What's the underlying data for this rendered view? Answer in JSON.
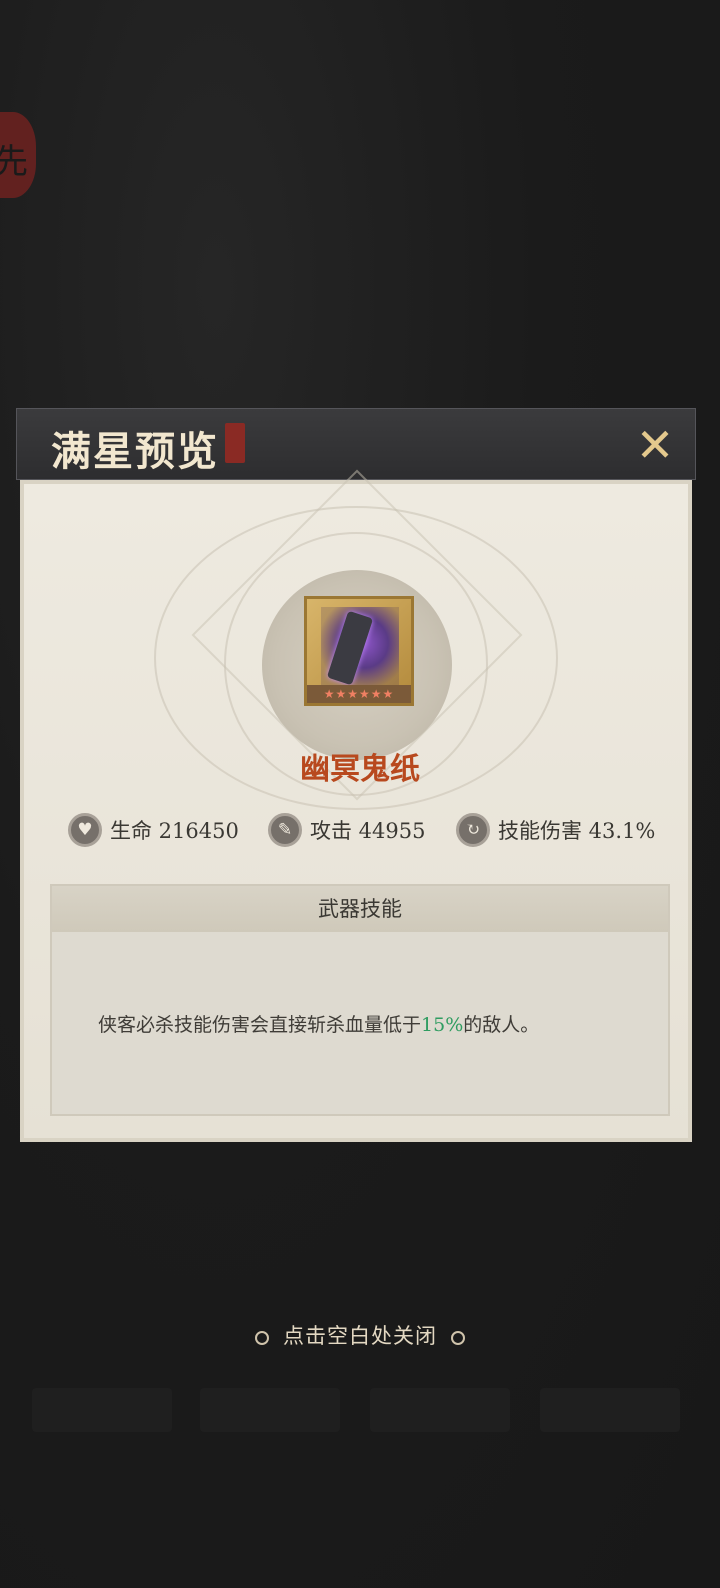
{
  "modal": {
    "title": "满星预览",
    "close_icon": "close-x-icon"
  },
  "weapon": {
    "name": "幽冥鬼纸",
    "stars": "★★★★★★",
    "star_count": 6
  },
  "stats": [
    {
      "icon": "heart-icon",
      "label": "生命 216450"
    },
    {
      "icon": "claw-icon",
      "label": "攻击 44955"
    },
    {
      "icon": "swirl-icon",
      "label": "技能伤害 43.1%"
    }
  ],
  "skill": {
    "header": "武器技能",
    "desc_before": "侠客必杀技能伤害会直接斩杀血量低于",
    "desc_highlight": "15%",
    "desc_after": "的敌人。",
    "highlight_color": "#2f9c60"
  },
  "footer": {
    "close_hint": "点击空白处关闭"
  },
  "colors": {
    "weapon_name": "#b8491e",
    "title_text": "#f2e7cf"
  }
}
